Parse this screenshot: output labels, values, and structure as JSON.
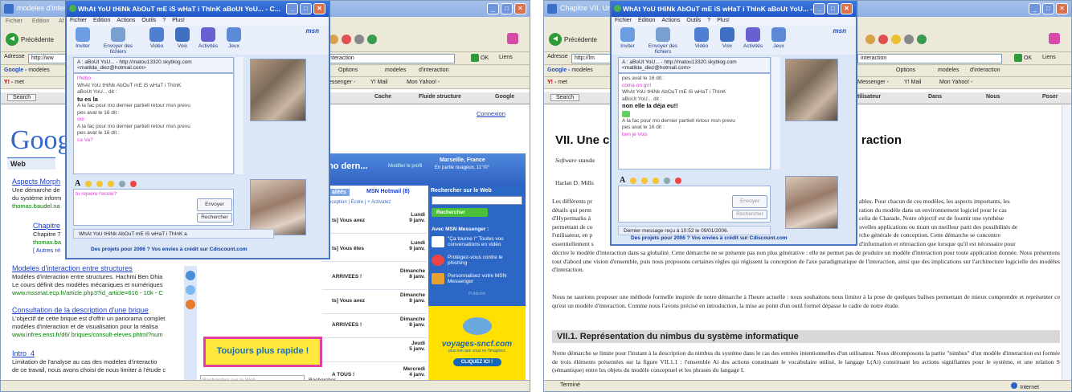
{
  "left": {
    "window_title": "modeles d'inter...",
    "menu": [
      "Fichier",
      "Edition",
      "Af"
    ],
    "back": "Précédente",
    "addr_label": "Adresse",
    "addr_value": "http://ww",
    "addr_value2": "nteraction",
    "go": "OK",
    "links": "Liens",
    "google_bar": "Google -",
    "google_field": "modeles",
    "options": "Options",
    "modeles_tab": "modeles",
    "interaction_tab": "d'interaction",
    "y_bar": "Y! -",
    "y_field": "met",
    "messenger": "essenger -",
    "ymail": "Y! Mail",
    "monyahoo": "Mon Yahoo! -",
    "search_btn": "Search",
    "tab_cache": "Cache",
    "tab_fluide": "Fluide structure",
    "tab_google": "Google",
    "connexion": "Connexion",
    "google_logo": "Goog",
    "web": "Web",
    "results": [
      {
        "title": "Aspects Morph",
        "snippet": "Une démarche de",
        "snippet2": "du système inform",
        "url": "thomas.baudel.na"
      },
      {
        "title": "Chapitre",
        "snippet": "Chapitre 7",
        "snippet2": "",
        "url": "thomas.ba",
        "extra": "[ Autres ré"
      },
      {
        "title": "Modeles d'interaction entre structures",
        "snippet": "Modèles d'interaction entre structures. Hachmi Ben Dhia",
        "snippet2": "Le cours définit des modèles mécaniques et numériques",
        "url": "www.mssmat.ecp.fr/article.php3?id_article=616 - 10k - C"
      },
      {
        "title": "Consultation de la description d'une brique",
        "snippet": "L'objectif de cette brique est d'offrir un panorama complet",
        "snippet2": "modèles d'interaction et de visualisation pour la réalisa",
        "url": "www.infres.enst.fr/d6/ briques/consult-eleves.phtml?num"
      },
      {
        "title": "Intro_4",
        "snippet": "Limitation de l'analyse au cas des modeles d'interactio",
        "snippet2": "de ce travail, nous avons choisi de nous limiter à l'étude c",
        "url": ""
      }
    ],
    "msn": {
      "title": "WhAt YoU tHiNk AbOuT mE iS wHaT i ThInK aBoUt YoU... - C...",
      "menu": [
        "Fichier",
        "Edition",
        "Actions",
        "Outils",
        "?",
        "Plus!"
      ],
      "tools": [
        "Inviter",
        "Envoyer des fichiers",
        "Vidéo",
        "Voix",
        "Activités",
        "Jeux"
      ],
      "logo": "msn",
      "to_line1": "A :  aBoUt YoU... - http://matou13320.skyblog.com",
      "to_line2": "<matilda_diez@hotmail.com>",
      "convo": [
        {
          "cls": "pink",
          "t": "l'hébo"
        },
        {
          "cls": "sys",
          "t": "WhAt YoU tHiNk AbOuT mE iS wHaT i ThInK"
        },
        {
          "cls": "sys",
          "t": "aBoUt YoU... dit :"
        },
        {
          "cls": "bold",
          "t": "tu es la"
        },
        {
          "cls": "sys",
          "t": "A la fac pour mo dernier partiell retour msn prevu"
        },
        {
          "cls": "sys",
          "t": "pes avat le 16 dit :"
        },
        {
          "cls": "pink",
          "t": "oui"
        },
        {
          "cls": "sys",
          "t": "A la fac pour mo dernier partiell retour msn prevu"
        },
        {
          "cls": "sys",
          "t": "pes avat le 16 dit :"
        },
        {
          "cls": "pink",
          "t": "ca Va?"
        }
      ],
      "input_text": "tu rejeeru l'ecole?",
      "send": "Envoyer",
      "search": "Rechercher",
      "tab_name": "WhAt YoU tHiNk AbOuT mE iS wHaT i ThInK a",
      "ad": "Des projets pour 2006 ? Vos envies à crédit sur Cdiscount.com"
    },
    "hotmail": {
      "head": "mo dern...",
      "head_sub": "Modifier le profil",
      "location": "Marseille, France",
      "weather": "En partie nuageux, 11°/0°",
      "tab_msn": "MSN Hotmail (8)",
      "tab_other": "alités",
      "sub": "eception | Écrire | + Activatez",
      "search_web": "Rechercher sur le Web",
      "search_btn": "Rechercher",
      "rows": [
        {
          "s": "ts] Vous avez",
          "d1": "Lundi",
          "d2": "9 janv."
        },
        {
          "s": "ts] Vous êtes",
          "d1": "Lundi",
          "d2": "9 janv."
        },
        {
          "s": "ARRIVEES !",
          "d1": "Dimanche",
          "d2": "8 janv."
        },
        {
          "s": "ts] Vous avez",
          "d1": "Dimanche",
          "d2": "8 janv."
        },
        {
          "s": "ARRIVEES !",
          "d1": "Dimanche",
          "d2": "8 janv."
        },
        {
          "s": "",
          "d1": "Jeudi",
          "d2": "5 janv."
        },
        {
          "s": "A TOUS !",
          "d1": "Mercredi",
          "d2": "4 janv."
        }
      ],
      "side_title": "Avec MSN Messenger :",
      "side_items": [
        "\"Ça tourne !\" Toutes vos conversations en vidéo",
        "Protégez-vous contre le phishing",
        "Personnalisez votre MSN Messenger"
      ],
      "pub": "Publicité",
      "voyages": "voyages-sncf.com",
      "voyages_sub": "plus loin que vous ne l'imaginez",
      "voyages_btn": "CLIQUEZ ICI !"
    },
    "ad_toujours": "Toujours plus rapide !",
    "search_web_placeholder": "Rechercher sur le Web",
    "search_web_btn": "Rechercher"
  },
  "right": {
    "window_title": "Chapitre VII. Un",
    "back": "Précédente",
    "addr_label": "Adresse",
    "addr_value": "http://lm",
    "addr_value2": "interaction",
    "go": "OK",
    "links": "Liens",
    "google_bar": "Google -",
    "google_field": "modeles",
    "options": "Options",
    "modeles_tab": "modeles",
    "interaction_tab": "d'interaction",
    "y_bar": "Y! -",
    "y_field": "met",
    "messenger": "Messenger -",
    "ymail": "Y! Mail",
    "monyahoo": "Mon Yahoo! -",
    "search_btn": "Search",
    "tab_util": "tilisateur",
    "tab_dans": "Dans",
    "tab_nous": "Nous",
    "tab_poser": "Poser",
    "msn": {
      "title": "WhAt YoU tHiNk AbOuT mE iS wHaT i ThInK aBoUt YoU... - C...",
      "menu": [
        "Fichier",
        "Edition",
        "Actions",
        "Outils",
        "?",
        "Plus!"
      ],
      "tools": [
        "Inviter",
        "Envoyer des fichiers",
        "Vidéo",
        "Voix",
        "Activités",
        "Jeux"
      ],
      "logo": "msn",
      "to_line1": "A :  aBoUt YoU... - http://matou13320.skyblog.com",
      "to_line2": "<matilda_diez@hotmail.com>",
      "convo": [
        {
          "cls": "sys",
          "t": "pes avat le 16 dit :"
        },
        {
          "cls": "pink",
          "t": "coma on grrl"
        },
        {
          "cls": "sys",
          "t": "WhAt YoU tHiNk AbOuT mE iS wHaT i ThInK"
        },
        {
          "cls": "sys",
          "t": "aBoUt YoU... dit :"
        },
        {
          "cls": "bold",
          "t": "non elle la déja  eu!!"
        },
        {
          "cls": "sys",
          "t": "A la fac pour mo dernier partiell retour msn prevu"
        },
        {
          "cls": "sys",
          "t": "pes avat le 16 dit :"
        },
        {
          "cls": "pink",
          "t": "ben je Vois"
        }
      ],
      "send": "Envoyer",
      "search": "Rechercher",
      "last_msg": "Dernier message reçu à 10:52 le 09/01/2006.",
      "ad": "Des projets pour 2006 ? Vos envies à crédit sur Cdiscount.com"
    },
    "doc": {
      "heading": "VII. Une c",
      "heading_right": "raction",
      "subtitle": "Software standa",
      "author": "Harlan D. Mills",
      "p1_left": "Les différents pr",
      "p1_lines_left": [
        "détails qui perm",
        "d'Hypermarks à",
        "permettant de co",
        "l'utilisateur, en p",
        "essentiellement s"
      ],
      "p1_lines_right": [
        "ables. Pour chacun de ces modèles, les aspects importants, les",
        "ration du modèle dans un environnement logiciel pour le cas",
        "celia de Charade. Notre objectif est de fournir une synthèse",
        "uvelles applications ou tirant un meilleur parti des possibilités de",
        "rche générale de conception. Cette démarche se concentre",
        "d'information et rétroaction que lorsque qu'il est nécessaire pour"
      ],
      "p1_full": "décrire le modèle d'interaction dans sa globalité. Cette démarche ne se présente pas non plus générative : elle ne permet pas de produire un modèle d'interaction pour toute application donnée. Nous présentons tout d'abord une vision d'ensemble, puis nous proposons certaines règles qui régissent la conception de l'axe paradigmatique de l'interaction, ainsi que des implications sur l'architecture logicielle des modèles d'interaction.",
      "p2": "Nous ne saurions proposer une méthode formelle inspirée de notre démarche à l'heure actuelle : nous souhaitons nous limiter à la pose de quelques balises permettant de mieux comprendre et représenter ce qu'est un modèle d'interaction. Comme nous l'avons précisé en introduction, la mise au point d'un outil formel dépasse le cadre de notre étude.",
      "section": "VII.1. Représentation du nimbus du système informatique",
      "p3": "Notre démarche se limite pour l'instant à la description du nimbus du système dans le cas des entrées intentionnelles d'un utilisateur. Nous décomposons la partie \"nimbus\" d'un modèle d'interaction est formée de trois éléments présentées sur la figure VII.1.1 : l'ensemble Ai des actions constituant le vocabulaire utilisé, le langage L(Ai) constituant les actions signifiantes pour le système, et une relation S (sémantique) entre les objets du modèle conceptuel et les phrases du langage L"
    },
    "status_left": "Terminé",
    "status_right": "Internet"
  },
  "colors": {
    "msn_blue": "#2056c8",
    "pink": "#d83ad0",
    "link": "#1a3fc8",
    "url": "#007a00"
  }
}
